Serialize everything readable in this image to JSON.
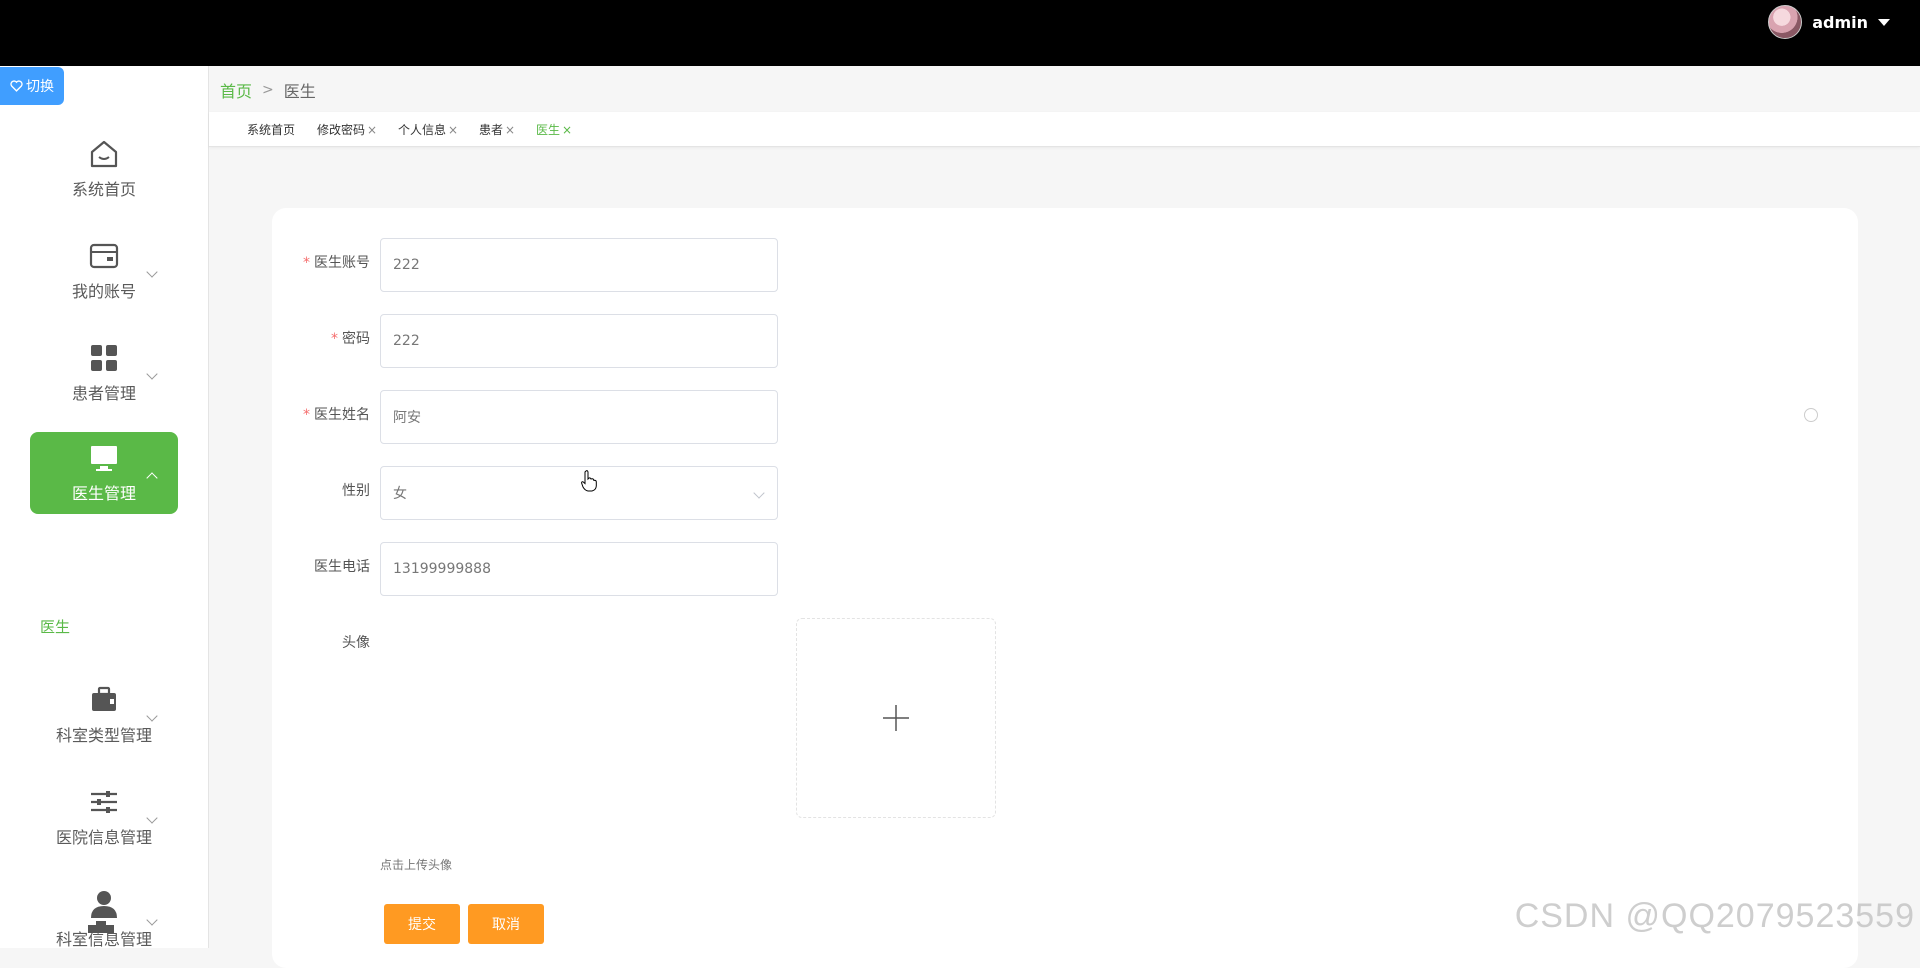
{
  "topbar": {
    "username": "admin"
  },
  "switch": {
    "label": "切换"
  },
  "sidebar": {
    "items": [
      {
        "label": "系统首页",
        "icon": "home-icon"
      },
      {
        "label": "我的账号",
        "icon": "wallet-icon"
      },
      {
        "label": "患者管理",
        "icon": "grid-icon"
      },
      {
        "label": "医生管理",
        "icon": "monitor-icon",
        "active": true
      },
      {
        "label": "科室类型管理",
        "icon": "briefcase-icon"
      },
      {
        "label": "医院信息管理",
        "icon": "sliders-icon"
      },
      {
        "label": "科室信息管理",
        "icon": "user-icon"
      }
    ],
    "submenu_label": "医生"
  },
  "breadcrumb": {
    "home": "首页",
    "separator": ">",
    "current": "医生"
  },
  "tags": [
    {
      "label": "系统首页",
      "closable": false
    },
    {
      "label": "修改密码",
      "closable": true
    },
    {
      "label": "个人信息",
      "closable": true
    },
    {
      "label": "患者",
      "closable": true
    },
    {
      "label": "医生",
      "closable": true,
      "active": true
    }
  ],
  "tag_close_glyph": "×",
  "form": {
    "fields": [
      {
        "label": "医生账号",
        "required": true,
        "value": "222"
      },
      {
        "label": "密码",
        "required": true,
        "value": "222"
      },
      {
        "label": "医生姓名",
        "required": true,
        "value": "阿安"
      },
      {
        "label": "性别",
        "required": false,
        "value": "女",
        "type": "select"
      },
      {
        "label": "医生电话",
        "required": false,
        "value": "13199999888"
      }
    ],
    "avatar_label": "头像",
    "upload_tip": "点击上传头像",
    "submit_label": "提交",
    "cancel_label": "取消",
    "required_mark": "*"
  },
  "watermark": "CSDN @QQ2079523559",
  "colors": {
    "accent": "#5ab947",
    "primary": "#409eff",
    "button": "#ff9a22",
    "required": "#f56c6c"
  }
}
